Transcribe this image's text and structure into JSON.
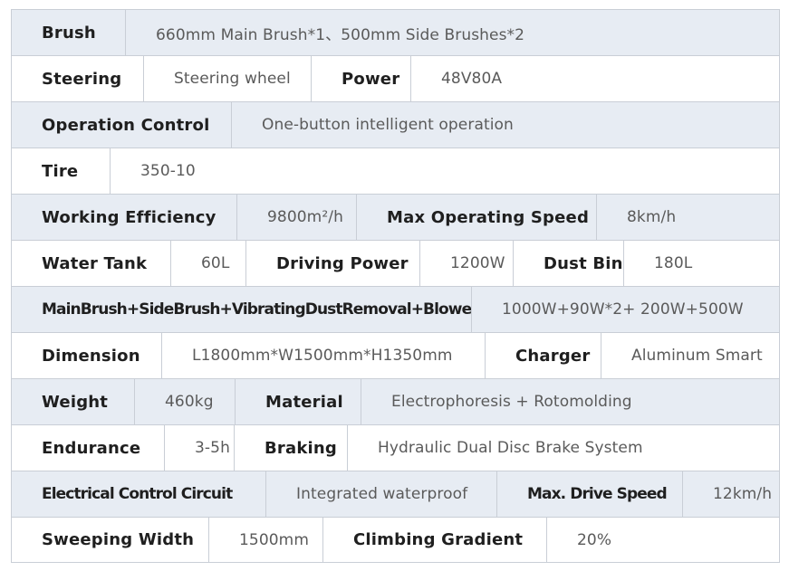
{
  "rows": [
    {
      "cells": [
        {
          "text": "Brush"
        },
        {
          "text": "660mm Main Brush*1、500mm Side Brushes*2"
        }
      ]
    },
    {
      "cells": [
        {
          "text": "Steering"
        },
        {
          "text": "Steering wheel"
        },
        {
          "text": "Power"
        },
        {
          "text": "48V80A"
        }
      ]
    },
    {
      "cells": [
        {
          "text": "Operation Control"
        },
        {
          "text": "One-button intelligent operation"
        }
      ]
    },
    {
      "cells": [
        {
          "text": "Tire"
        },
        {
          "text": "350-10"
        }
      ]
    },
    {
      "cells": [
        {
          "text": "Working Efficiency"
        },
        {
          "text": "9800m²/h"
        },
        {
          "text": "Max Operating Speed"
        },
        {
          "text": "8km/h"
        }
      ]
    },
    {
      "cells": [
        {
          "text": "Water Tank"
        },
        {
          "text": "60L"
        },
        {
          "text": "Driving Power"
        },
        {
          "text": "1200W"
        },
        {
          "text": "Dust Bin"
        },
        {
          "text": "180L"
        }
      ]
    },
    {
      "cells": [
        {
          "text": "MainBrush+SideBrush+VibratingDustRemoval+Blower"
        },
        {
          "text": "1000W+90W*2+ 200W+500W"
        }
      ]
    },
    {
      "cells": [
        {
          "text": "Dimension"
        },
        {
          "text": "L1800mm*W1500mm*H1350mm"
        },
        {
          "text": "Charger"
        },
        {
          "text": "Aluminum Smart"
        }
      ]
    },
    {
      "cells": [
        {
          "text": "Weight"
        },
        {
          "text": "460kg"
        },
        {
          "text": "Material"
        },
        {
          "text": "Electrophoresis + Rotomolding"
        }
      ]
    },
    {
      "cells": [
        {
          "text": "Endurance"
        },
        {
          "text": "3-5h"
        },
        {
          "text": "Braking"
        },
        {
          "text": "Hydraulic Dual Disc Brake System"
        }
      ]
    },
    {
      "cells": [
        {
          "text": "Electrical Control Circuit"
        },
        {
          "text": "Integrated waterproof"
        },
        {
          "text": "Max. Drive Speed"
        },
        {
          "text": "12km/h"
        }
      ]
    },
    {
      "cells": [
        {
          "text": "Sweeping Width"
        },
        {
          "text": "1500mm"
        },
        {
          "text": "Climbing Gradient"
        },
        {
          "text": "20%"
        }
      ]
    }
  ]
}
